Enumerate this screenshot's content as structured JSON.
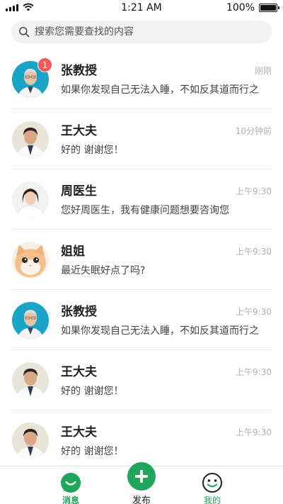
{
  "status_bar": {
    "time": "1:21 AM",
    "battery_text": "100%",
    "battery_level": 1.0
  },
  "search": {
    "placeholder": "搜索您需要查找的内容"
  },
  "chats": [
    {
      "name": "张教授",
      "time": "刚刚",
      "preview": "如果你发现自己无法入睡，不如反其道而行之",
      "unread": "1",
      "avatar": "professor-avatar"
    },
    {
      "name": "王大夫",
      "time": "10分钟前",
      "preview": "好的 谢谢您！",
      "avatar": "doctor-avatar"
    },
    {
      "name": "周医生",
      "time": "上午9:30",
      "preview": "您好周医生，我有健康问题想要咨询您",
      "avatar": "female-doctor-avatar"
    },
    {
      "name": "姐姐",
      "time": "上午9:30",
      "preview": "最近失眠好点了吗?",
      "avatar": "cat-avatar"
    },
    {
      "name": "张教授",
      "time": "上午9:30",
      "preview": "如果你发现自己无法入睡，不如反其道而行之",
      "avatar": "professor-avatar"
    },
    {
      "name": "王大夫",
      "time": "上午9:30",
      "preview": "好的 谢谢您！",
      "avatar": "doctor-avatar"
    },
    {
      "name": "王大夫",
      "time": "上午9:30",
      "preview": "好的 谢谢您！",
      "avatar": "doctor-avatar"
    }
  ],
  "tab_bar": {
    "messages": "消息",
    "publish": "发布",
    "mine": "我的"
  },
  "colors": {
    "accent": "#1fa65a",
    "badge": "#f05a5a"
  }
}
